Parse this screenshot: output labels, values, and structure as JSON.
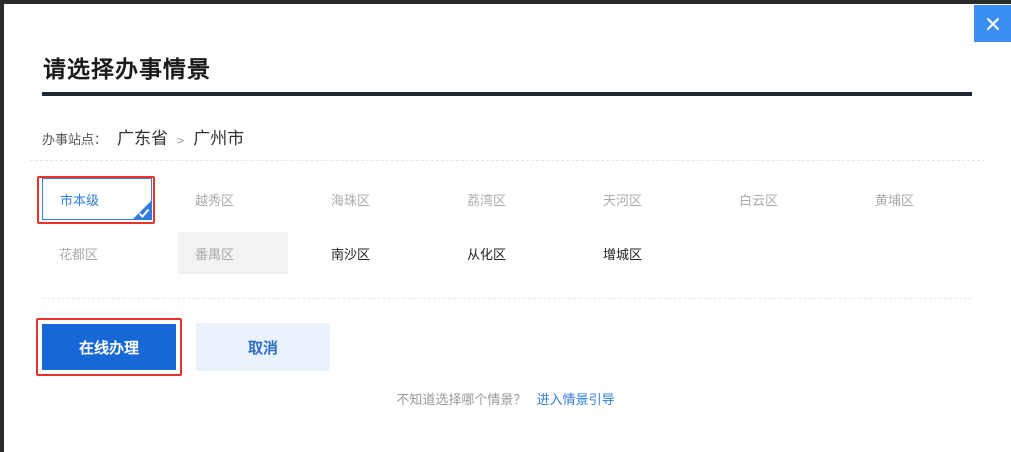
{
  "dialog": {
    "title": "请选择办事情景",
    "close_icon": "close-icon",
    "breadcrumb": {
      "label": "办事站点：",
      "province": "广东省",
      "separator": ">",
      "city": "广州市"
    },
    "districts": [
      {
        "label": "市本级",
        "state": "selected"
      },
      {
        "label": "越秀区",
        "state": "muted"
      },
      {
        "label": "海珠区",
        "state": "muted"
      },
      {
        "label": "荔湾区",
        "state": "muted"
      },
      {
        "label": "天河区",
        "state": "muted"
      },
      {
        "label": "白云区",
        "state": "muted"
      },
      {
        "label": "黄埔区",
        "state": "muted"
      },
      {
        "label": "花都区",
        "state": "muted"
      },
      {
        "label": "番禺区",
        "state": "disabled"
      },
      {
        "label": "南沙区",
        "state": "active"
      },
      {
        "label": "从化区",
        "state": "active"
      },
      {
        "label": "增城区",
        "state": "active"
      }
    ],
    "buttons": {
      "online": "在线办理",
      "cancel": "取消"
    },
    "hint": {
      "question": "不知道选择哪个情景？",
      "link": "进入情景引导"
    }
  },
  "colors": {
    "accent": "#1867d6",
    "highlight": "#e8332b",
    "close_bg": "#3b8ff3"
  }
}
